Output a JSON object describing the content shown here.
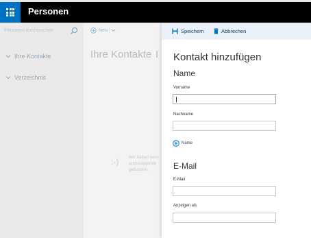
{
  "app": {
    "title": "Personen"
  },
  "left_pane": {
    "search_placeholder": "Personen durchsuchen",
    "items": [
      {
        "label": "Ihre Kontakte"
      },
      {
        "label": "Verzeichnis"
      }
    ]
  },
  "middle_pane": {
    "new_label": "Neu",
    "new_separator": "|",
    "title": "Ihre Kontakte",
    "title_fragment": "I",
    "empty_text": "Wir haben kein anzuzeigende gefunden.",
    "empty_icon": ":-)"
  },
  "panel": {
    "save_label": "Speichern",
    "cancel_label": "Abbrechen",
    "title": "Kontakt hinzufügen",
    "name_section": "Name",
    "first_name_label": "Vorname",
    "first_name_value": "",
    "last_name_label": "Nachname",
    "last_name_value": "",
    "add_name_label": "Name",
    "email_section": "E-Mail",
    "email_label": "E-Mail",
    "email_value": "",
    "display_as_label": "Anzeigen als",
    "display_as_value": ""
  },
  "colors": {
    "accent": "#0072c6",
    "appbar": "#000000",
    "command_bar": "#eaf1f8",
    "link": "#1a3f66"
  }
}
